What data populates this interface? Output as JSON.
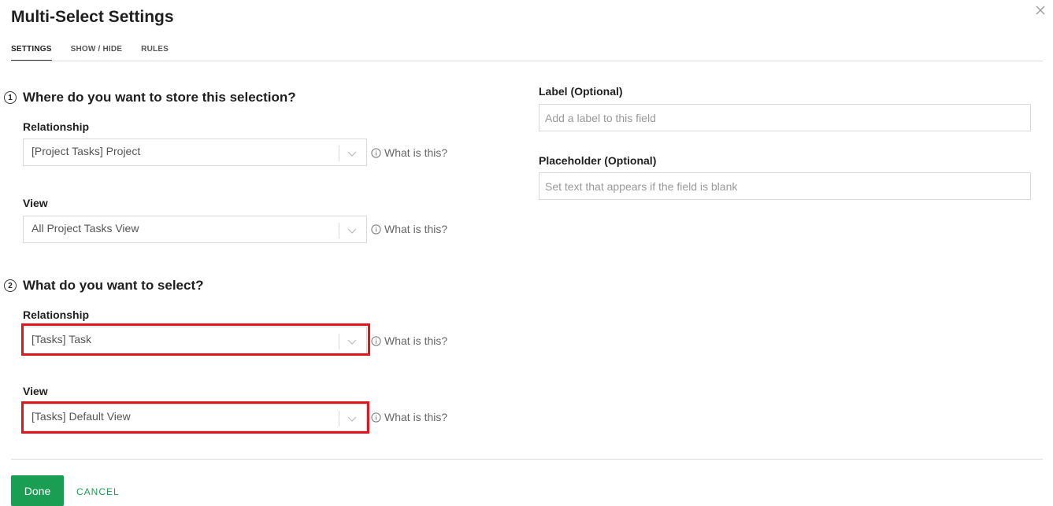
{
  "header": {
    "title": "Multi-Select Settings"
  },
  "tabs": [
    {
      "label": "SETTINGS",
      "active": true
    },
    {
      "label": "SHOW / HIDE",
      "active": false
    },
    {
      "label": "RULES",
      "active": false
    }
  ],
  "section1": {
    "number": "1",
    "title": "Where do you want to store this selection?",
    "relationship_label": "Relationship",
    "relationship_value": "[Project Tasks] Project",
    "view_label": "View",
    "view_value": "All Project Tasks View"
  },
  "section2": {
    "number": "2",
    "title": "What do you want to select?",
    "relationship_label": "Relationship",
    "relationship_value": "[Tasks] Task",
    "view_label": "View",
    "view_value": "[Tasks] Default View"
  },
  "help_text": "What is this?",
  "right": {
    "label_title": "Label (Optional)",
    "label_placeholder": "Add a label to this field",
    "placeholder_title": "Placeholder (Optional)",
    "placeholder_placeholder": "Set text that appears if the field is blank"
  },
  "footer": {
    "done_label": "Done",
    "cancel_label": "CANCEL"
  },
  "colors": {
    "accent": "#1a9e54",
    "highlight": "#e0161e"
  }
}
